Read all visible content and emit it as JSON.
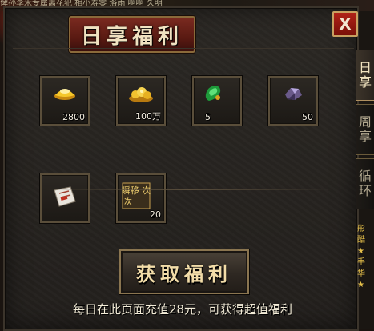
{
  "background": {
    "top_strip_text": "俾孙李禾专属离花犯 相小寿零 洛雨 啊啊 久明",
    "right_strip_text": "彤 酷 ★ 手 华 ★"
  },
  "window": {
    "title": "日享福利",
    "close_label": "X"
  },
  "rewards": [
    {
      "name": "gold-ingot",
      "qty": "2800",
      "icon": "gold-ingot-icon"
    },
    {
      "name": "gold-pile",
      "qty": "100万",
      "icon": "gold-pile-icon"
    },
    {
      "name": "jade-gem",
      "qty": "5",
      "icon": "green-jade-icon"
    },
    {
      "name": "purple-ore",
      "qty": "50",
      "icon": "purple-ore-icon"
    },
    {
      "name": "scroll",
      "qty": "",
      "icon": "scroll-icon"
    },
    {
      "name": "teleport-stone",
      "qty": "20",
      "icon": "teleport-icon",
      "label": "瞬移 次"
    }
  ],
  "action": {
    "button_label": "获取福利",
    "info": "每日在此页面充值28元，可获得超值福利"
  },
  "side_tabs": [
    {
      "label_top": "日",
      "label_bottom": "享",
      "active": true
    },
    {
      "label_top": "周",
      "label_bottom": "享",
      "active": false
    },
    {
      "label_top": "循",
      "label_bottom": "环",
      "active": false
    }
  ],
  "colors": {
    "panel_bg": "#272421",
    "title_red": "#5a1a12",
    "border_gold": "#8a7550",
    "close_red": "#b02218"
  }
}
